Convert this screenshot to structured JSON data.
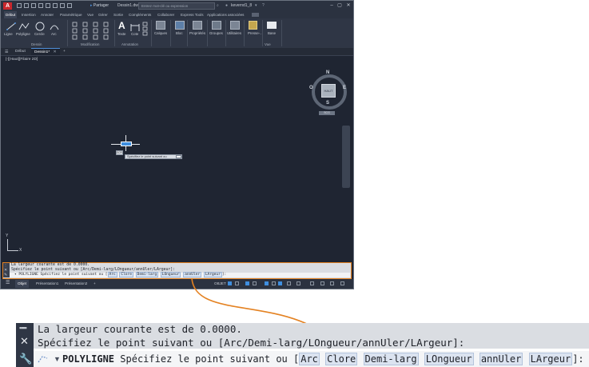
{
  "title_bar": {
    "logo": "A",
    "share": "Partager",
    "file_name": "Dessin1.dwg",
    "search_placeholder": "Entrez mot-clé ou expression",
    "user": "kevernd1_8"
  },
  "ribbon_tabs": [
    "Début",
    "Insertion",
    "Annoter",
    "Paramétrique",
    "Vue",
    "Gérer",
    "Sortie",
    "Compléments",
    "Collaborer",
    "Express Tools",
    "Applications associées"
  ],
  "ribbon": {
    "tools": [
      "Ligne",
      "Polyligne",
      "Cercle",
      "Arc",
      "Texte",
      "Cote",
      "Calques",
      "Bloc",
      "Propriétés",
      "Groupes",
      "Utilitaires",
      "Presse-...",
      "Base"
    ],
    "panels": [
      "Dessin",
      "Modification",
      "Annotation",
      "Vue"
    ]
  },
  "file_tabs": {
    "tabs": [
      "Début",
      "Dessin1*"
    ],
    "add": "+"
  },
  "viewport": {
    "label": "[-][Haut][Filaire 2D]",
    "compass": {
      "center": "HAUT",
      "n": "N",
      "s": "S",
      "e": "E",
      "w": "O",
      "wcs": "SCG"
    },
    "tooltip_icon": "SCR",
    "tooltip": "Spécifiez le point suivant ou",
    "ucs_x": "X",
    "ucs_y": "Y"
  },
  "command_line_small": {
    "history1": "La largeur courante est de 0.0000.",
    "history2": "Spécifiez le point suivant ou [Arc/Demi-larg/LOngueur/annUler/LArgeur]:",
    "input_prefix": "POLYLIGNE Spécifiez le point suivant ou [",
    "options": [
      "Arc",
      "Clore",
      "Demi-larg",
      "LOngueur",
      "annUler",
      "LArgeur"
    ],
    "input_suffix": "]:"
  },
  "status_bar": {
    "layout_tabs": [
      "Objet",
      "Présentation1",
      "Présentation2"
    ],
    "add": "+",
    "model": "OBJET"
  },
  "command_line_large": {
    "history1": "La largeur courante est de 0.0000.",
    "history2": "Spécifiez le point suivant ou [Arc/Demi-larg/LOngueur/annUler/LArgeur]:",
    "command": "POLYLIGNE",
    "prompt": "Spécifiez le point suivant ou [",
    "options": [
      "Arc",
      "Clore",
      "Demi-larg",
      "LOngueur",
      "annUler",
      "LArgeur"
    ],
    "suffix": "]:"
  },
  "colors": {
    "highlight": "#e48222",
    "app_bg": "#1f2532",
    "accent": "#3f8fe0"
  }
}
